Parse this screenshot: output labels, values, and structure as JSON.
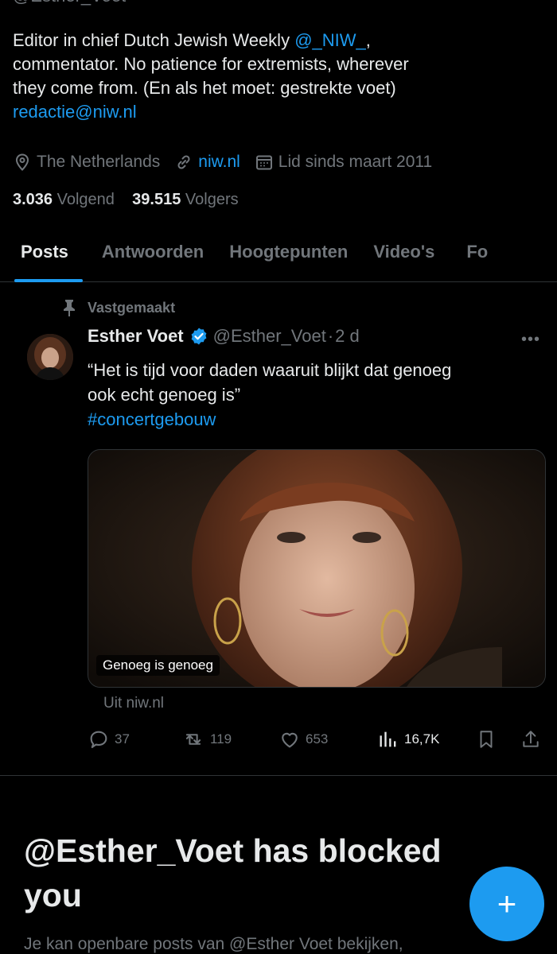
{
  "profile": {
    "top_handle": "@Esther_Voet",
    "bio": {
      "line1_pre": "Editor in chief Dutch Jewish Weekly ",
      "line1_mention": "@_NIW_",
      "line1_post": ",",
      "line2": "commentator. No patience for extremists, wherever",
      "line3": "they come from. (En als het moet: gestrekte voet)",
      "email": "redactie@niw.nl"
    },
    "location": "The Netherlands",
    "website": "niw.nl",
    "joined": "Lid sinds maart 2011",
    "following_count": "3.036",
    "following_label": "Volgend",
    "followers_count": "39.515",
    "followers_label": "Volgers"
  },
  "tabs": [
    "Posts",
    "Antwoorden",
    "Hoogtepunten",
    "Video's",
    "Fo"
  ],
  "active_tab": "Posts",
  "pinned_post": {
    "pinned_label": "Vastgemaakt",
    "author_name": "Esther Voet",
    "author_handle": "@Esther_Voet",
    "separator": "·",
    "time": "2 d",
    "more": "•••",
    "text_line1": "“Het is tijd voor daden waaruit blijkt dat genoeg",
    "text_line2": "ook echt genoeg is”",
    "hashtag": "#concertgebouw",
    "card_caption": "Genoeg is genoeg",
    "card_source": "Uit niw.nl",
    "stats": {
      "replies": "37",
      "reposts": "119",
      "likes": "653",
      "views": "16,7K"
    }
  },
  "blocked": {
    "title_line1": "@Esther_Voet has blocked",
    "title_line2": "you",
    "subtitle": "Je kan openbare posts van @Esther Voet bekijken,"
  },
  "fab": {
    "icon": "plus-icon",
    "label": "+"
  },
  "colors": {
    "accent": "#1d9bf0",
    "muted": "#71767b",
    "text": "#e7e9ea",
    "bg": "#000000"
  }
}
